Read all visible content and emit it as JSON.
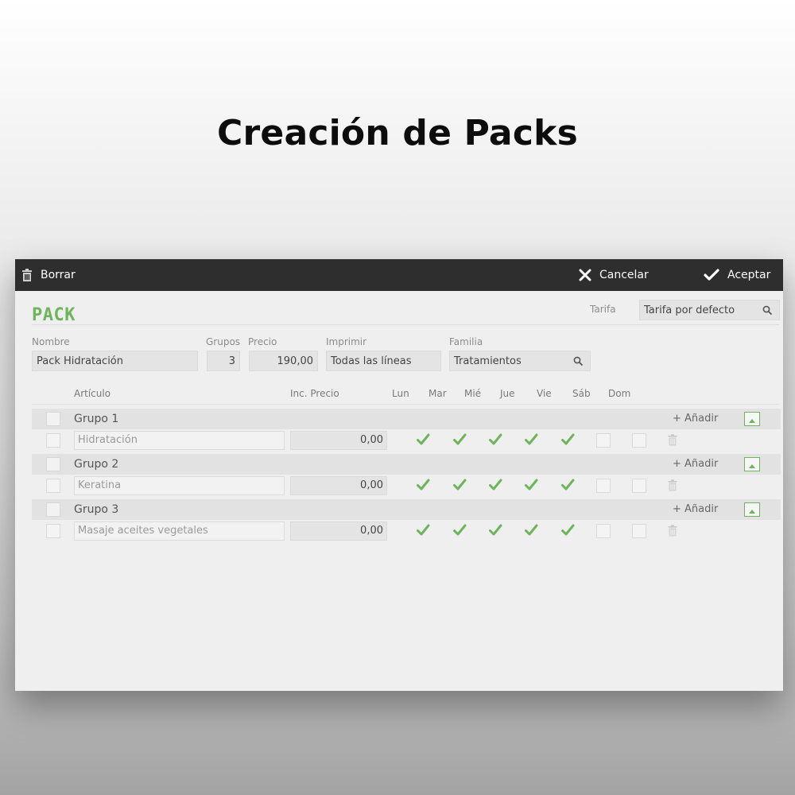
{
  "heading": "Creación de Packs",
  "toolbar": {
    "delete_label": "Borrar",
    "cancel_label": "Cancelar",
    "accept_label": "Aceptar"
  },
  "form": {
    "title": "PACK",
    "tariff_label": "Tarifa",
    "tariff_value": "Tarifa por defecto",
    "name_label": "Nombre",
    "name_value": "Pack Hidratación",
    "groups_label": "Grupos",
    "groups_value": "3",
    "price_label": "Precio",
    "price_value": "190,00",
    "print_label": "Imprimir",
    "print_value": "Todas las líneas",
    "family_label": "Familia",
    "family_value": "Tratamientos"
  },
  "columns": {
    "article": "Artículo",
    "inc_price": "Inc. Precio",
    "days": [
      "Lun",
      "Mar",
      "Mié",
      "Jue",
      "Vie",
      "Sáb",
      "Dom"
    ]
  },
  "add_label": "+ Añadir",
  "groups": [
    {
      "name": "Grupo 1",
      "item": "Hidratación",
      "inc": "0,00",
      "days": [
        true,
        true,
        true,
        true,
        true,
        false,
        false
      ]
    },
    {
      "name": "Grupo 2",
      "item": "Keratina",
      "inc": "0,00",
      "days": [
        true,
        true,
        true,
        true,
        true,
        false,
        false
      ]
    },
    {
      "name": "Grupo 3",
      "item": "Masaje aceites vegetales",
      "inc": "0,00",
      "days": [
        true,
        true,
        true,
        true,
        true,
        false,
        false
      ]
    }
  ],
  "colors": {
    "accent": "#6db45a",
    "toolbar": "#2e2e2e"
  }
}
